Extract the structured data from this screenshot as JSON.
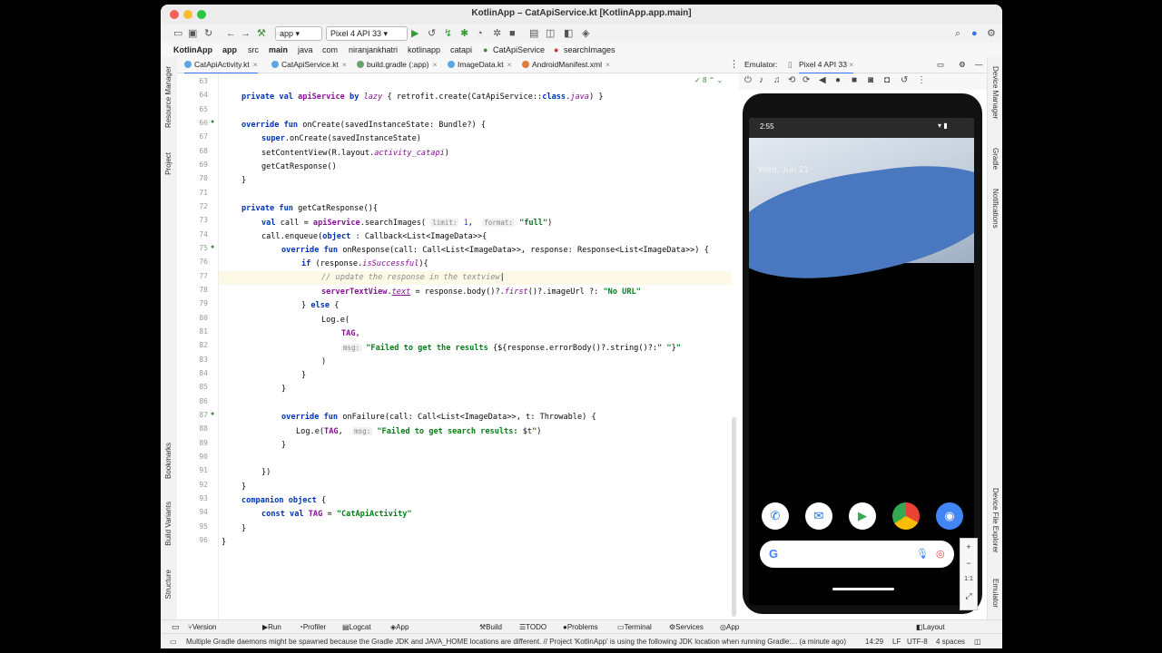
{
  "window": {
    "title": "KotlinApp – CatApiService.kt [KotlinApp.app.main]"
  },
  "toolbar": {
    "config": "app",
    "device": "Pixel 4 API 33"
  },
  "breadcrumbs": [
    "KotlinApp",
    "app",
    "src",
    "main",
    "java",
    "com",
    "niranjankhatri",
    "kotlinapp",
    "catapi",
    "CatApiService",
    "searchImages"
  ],
  "tabs": [
    "CatApiActivity.kt",
    "CatApiService.kt",
    "build.gradle (:app)",
    "ImageData.kt",
    "AndroidManifest.xml"
  ],
  "left_strip": [
    "Resource Manager",
    "Project",
    "Bookmarks",
    "Build Variants",
    "Structure"
  ],
  "right_strip": [
    "Device Manager",
    "Gradle",
    "Notifications",
    "Device File Explorer",
    "Emulator"
  ],
  "editor": {
    "warnings": "8",
    "line_numbers": [
      "63",
      "64",
      "65",
      "66",
      "67",
      "68",
      "69",
      "70",
      "71",
      "72",
      "73",
      "74",
      "75",
      "76",
      "77",
      "78",
      "79",
      "80",
      "81",
      "82",
      "83",
      "84",
      "85",
      "86",
      "87",
      "88",
      "89",
      "90",
      "91",
      "92",
      "93",
      "94",
      "95",
      "96"
    ],
    "hints": {
      "limit": "limit:",
      "format": "format:",
      "msg": "msg:"
    }
  },
  "emulator": {
    "label": "Emulator:",
    "device": "Pixel 4 API 33",
    "time": "2:55",
    "date": "Wed, Jun 21"
  },
  "tool_windows": [
    "Version Control",
    "Run",
    "Profiler",
    "Logcat",
    "App Quality Insights",
    "Build",
    "TODO",
    "Problems",
    "Terminal",
    "Services",
    "App Inspection",
    "Layout Inspector"
  ],
  "status": {
    "message": "Multiple Gradle daemons might be spawned because the Gradle JDK and JAVA_HOME locations are different. // Project 'KotlinApp' is using the following JDK location when running Gradle:... (a minute ago)",
    "position": "14:29",
    "line_sep": "LF",
    "encoding": "UTF-8",
    "indent": "4 spaces"
  },
  "colors": {
    "keyword": "#0033b3",
    "string": "#067d17",
    "accent": "#3574f0"
  }
}
